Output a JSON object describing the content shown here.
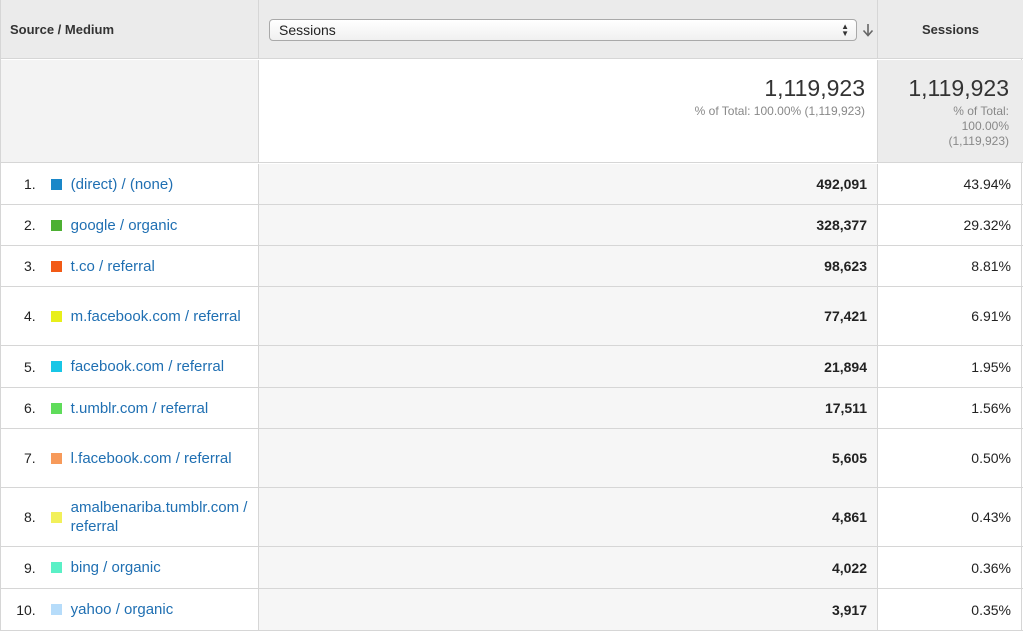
{
  "header": {
    "col1": "Source / Medium",
    "metric_selected": "Sessions",
    "col3": "Sessions"
  },
  "totals": {
    "value": "1,119,923",
    "percent_label": "% of Total: 100.00% (1,119,923)",
    "col3_value": "1,119,923",
    "col3_line1": "% of Total:",
    "col3_line2": "100.00%",
    "col3_line3": "(1,119,923)"
  },
  "rows": [
    {
      "idx": "1.",
      "color": "#1a87c8",
      "source": "(direct) / (none)",
      "value": "492,091",
      "pct": "43.94%"
    },
    {
      "idx": "2.",
      "color": "#4db033",
      "source": "google / organic",
      "value": "328,377",
      "pct": "29.32%"
    },
    {
      "idx": "3.",
      "color": "#f25a16",
      "source": "t.co / referral",
      "value": "98,623",
      "pct": "8.81%"
    },
    {
      "idx": "4.",
      "color": "#e8ef1a",
      "source": "m.facebook.com / referral",
      "value": "77,421",
      "pct": "6.91%"
    },
    {
      "idx": "5.",
      "color": "#18c6e6",
      "source": "facebook.com / referral",
      "value": "21,894",
      "pct": "1.95%"
    },
    {
      "idx": "6.",
      "color": "#5fdc5a",
      "source": "t.umblr.com / referral",
      "value": "17,511",
      "pct": "1.56%"
    },
    {
      "idx": "7.",
      "color": "#f79a5a",
      "source": "l.facebook.com / referral",
      "value": "5,605",
      "pct": "0.50%"
    },
    {
      "idx": "8.",
      "color": "#f2f05a",
      "source": "amalbenariba.tumblr.com / referral",
      "value": "4,861",
      "pct": "0.43%"
    },
    {
      "idx": "9.",
      "color": "#5af0c6",
      "source": "bing / organic",
      "value": "4,022",
      "pct": "0.36%"
    },
    {
      "idx": "10.",
      "color": "#b6dcfa",
      "source": "yahoo / organic",
      "value": "3,917",
      "pct": "0.35%"
    }
  ]
}
